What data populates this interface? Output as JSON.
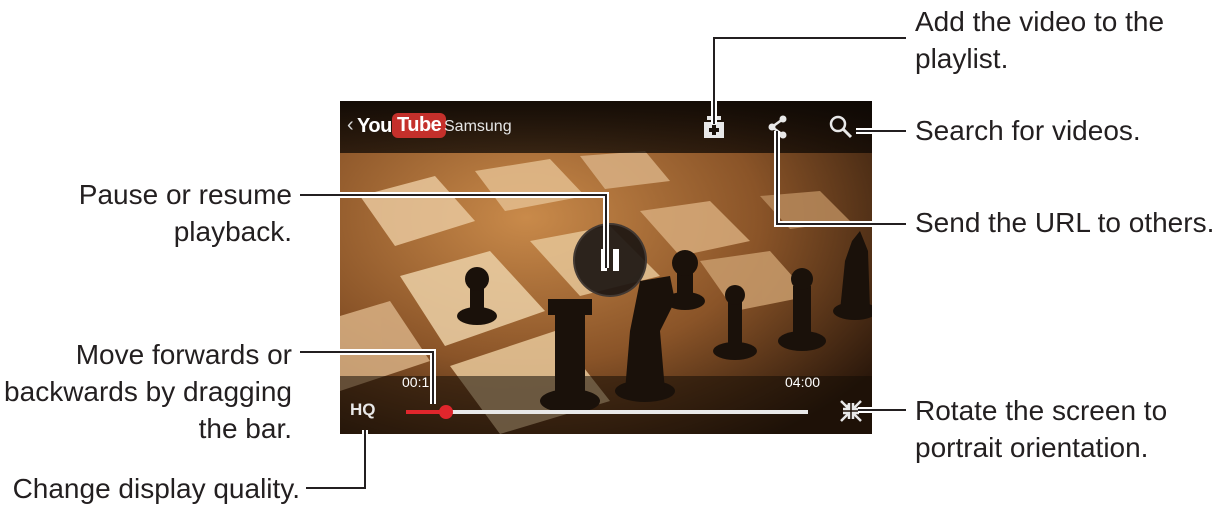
{
  "player": {
    "brand_you": "You",
    "brand_tube": "Tube",
    "channel": "Samsung",
    "current_time": "00:1",
    "duration": "04:00",
    "quality_label": "HQ",
    "progress": 0.1
  },
  "callouts": {
    "add_playlist": [
      "Add the video to the",
      "playlist."
    ],
    "search": "Search for videos.",
    "pause_resume": [
      "Pause or resume",
      "playback."
    ],
    "send_url": "Send the URL to others.",
    "move": [
      "Move forwards or",
      "backwards by dragging",
      "the bar."
    ],
    "rotate": [
      "Rotate the screen to",
      "portrait orientation."
    ],
    "quality": "Change display quality."
  },
  "icons": [
    "back-chevron-icon",
    "add-to-playlist-icon",
    "share-icon",
    "search-icon",
    "pause-icon",
    "fullscreen-exit-icon"
  ],
  "colors": {
    "youtube_red": "#c4302b",
    "seek_red": "#e0262c",
    "callout_line": "#00a0dc"
  }
}
